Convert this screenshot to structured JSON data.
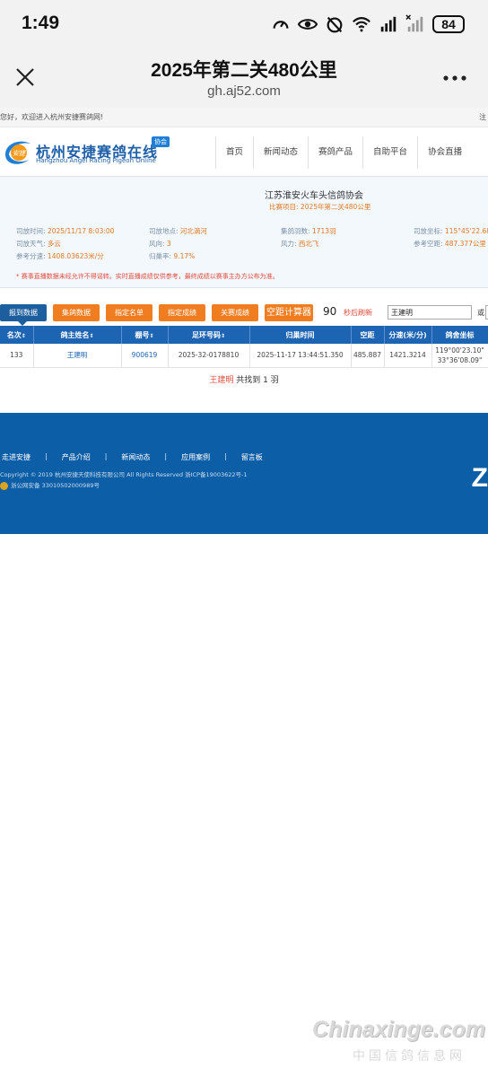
{
  "status_bar": {
    "time": "1:49",
    "battery": "84",
    "icons": [
      "speed-icon",
      "eye-icon",
      "alarm-off-icon",
      "wifi-icon",
      "signal-4g-icon",
      "signal-x-icon",
      "battery-icon"
    ]
  },
  "browser": {
    "title": "2025年第二关480公里",
    "url": "gh.aj52.com"
  },
  "site": {
    "welcome": "您好，欢迎进入杭州安捷赛鸽网!",
    "brand_cn": "杭州安捷赛鸽在线",
    "brand_en": "Hangzhou Angel Racing Pigeon Online",
    "brand_badge": "协会",
    "logo_text": "安捷",
    "nav": [
      "首页",
      "新闻动态",
      "赛鸽产品",
      "自助平台",
      "协会直播"
    ]
  },
  "race_info": {
    "association": "江苏淮安火车头信鸽协会",
    "project_label": "比赛项目:",
    "project": "2025年第二关480公里",
    "rows": [
      [
        {
          "label": "司放时间:",
          "value": "2025/11/17 8:03:00"
        },
        {
          "label": "司放地点:",
          "value": "河北滴河"
        },
        {
          "label": "集鸽羽数:",
          "value": "1713羽"
        },
        {
          "label": "司放坐标:",
          "value": "115°45'22.68\"/"
        }
      ],
      [
        {
          "label": "司放天气:",
          "value": "多云"
        },
        {
          "label": "风向:",
          "value": "3"
        },
        {
          "label": "风力:",
          "value": "西北飞"
        },
        {
          "label": "参考空距:",
          "value": "487.377公里"
        }
      ],
      [
        {
          "label": "参考分速:",
          "value": "1408.03623米/分"
        },
        {
          "label": "归巢率:",
          "value": "9.17%"
        }
      ]
    ],
    "notice": "* 赛事直播数据未经允许不得谣转。实时直播成绩仅供参考，最终成绩以赛事主办方公布为准。"
  },
  "toolbar": {
    "buttons": [
      "报到数据",
      "集鸽数据",
      "指定名单",
      "指定成绩",
      "关赛成绩",
      "空距计算器"
    ],
    "refresh_seconds": "90",
    "refresh_text": "秒后刷新",
    "search_value": "王建明",
    "or_label": "或"
  },
  "table": {
    "headers": [
      "名次",
      "鸽主姓名",
      "棚号",
      "足环号码",
      "归巢时间",
      "空距",
      "分速(米/分)",
      "鸽舍坐标"
    ],
    "rows": [
      {
        "rank": "133",
        "owner": "王建明",
        "loft": "900619",
        "ring": "2025-32-0178810",
        "time": "2025-11-17 13:44:51.350",
        "distance": "485.887",
        "speed": "1421.3214",
        "coord_lon": "119°00'23.10\"",
        "coord_lat": "33°36'08.09\""
      }
    ],
    "found_name": "王建明",
    "found_text": "共找到 1 羽"
  },
  "footer": {
    "links": [
      "走进安捷",
      "产品介绍",
      "新闻动态",
      "应用案例",
      "留言板"
    ],
    "separator": "|",
    "copyright": "Copyright © 2019 杭州安捷天使科技有限公司 All Rights Reserved 浙ICP备19003622号-1",
    "police": "浙公网安备 33010502000989号",
    "edge_char": "Z"
  },
  "watermark": {
    "main": "Chinaxinge.com",
    "sub": "中国信鸽信息网"
  },
  "colors": {
    "header_blue": "#1d64b3",
    "footer_blue": "#0c5fa6",
    "orange": "#f07e20",
    "red": "#e14b3b"
  }
}
